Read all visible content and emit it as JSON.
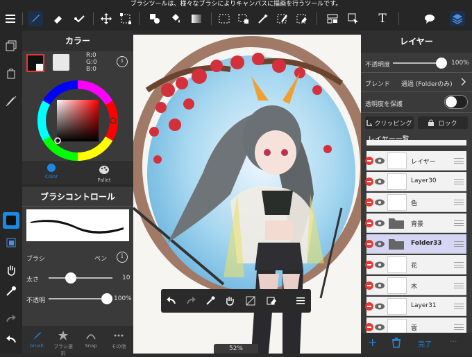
{
  "tooltip": "ブラシツールは、様々なブラシによりキャンバスに描画を行うツールです。",
  "toolbar": {
    "icons": [
      "menu-icon",
      "brush-icon",
      "eraser-icon",
      "smudge-icon",
      "move-icon",
      "transform-icon",
      "fill-icon",
      "bucket-icon",
      "gradient-icon",
      "select-rect-icon",
      "select-lasso-icon",
      "magic-wand-icon",
      "select-pen-icon",
      "select-eraser-icon",
      "layout-icon",
      "select-move-icon",
      "text-icon",
      "speech-icon",
      "layers-icon"
    ],
    "text_icon": "T"
  },
  "color": {
    "title": "カラー",
    "r": "R:0",
    "g": "G:0",
    "b": "B:0",
    "info": "i",
    "tab_color": "Color",
    "tab_pallet": "Pallet"
  },
  "brush": {
    "title": "ブラシコントロール",
    "brush_label": "ブラシ",
    "brush_value": "ペン",
    "size_label": "太さ",
    "size_value": "10",
    "size_fraction": 0.35,
    "opacity_label": "不透明",
    "opacity_value": "100%",
    "opacity_fraction": 1.0,
    "info": "i",
    "tabs": [
      "brush",
      "ブラシ選択",
      "Snap",
      "その他"
    ]
  },
  "canvas": {
    "zoom": "52%"
  },
  "layer": {
    "title": "レイヤー",
    "opacity_label": "不透明度",
    "opacity_value": "100%",
    "opacity_fraction": 1.0,
    "blend_label": "ブレンド",
    "blend_value": "通過 (Folderのみ)",
    "protect_label": "透明度を保護",
    "clipping_label": "クリッピング",
    "lock_label": "ロック",
    "list_title": "レイヤー一覧",
    "rows": [
      {
        "name": "レイヤー",
        "selected": false
      },
      {
        "name": "Layer30",
        "selected": false
      },
      {
        "name": "色",
        "selected": false
      },
      {
        "name": "背景",
        "selected": false
      },
      {
        "name": "Folder33",
        "selected": true
      },
      {
        "name": "花",
        "selected": false
      },
      {
        "name": "木",
        "selected": false
      },
      {
        "name": "Layer31",
        "selected": false
      },
      {
        "name": "雲",
        "selected": false
      }
    ],
    "add": "+",
    "done": "完了",
    "more": "···"
  },
  "colors": {
    "accent": "#1e88e5",
    "selected_row": "#d4d6f4",
    "delete": "#e53935"
  }
}
